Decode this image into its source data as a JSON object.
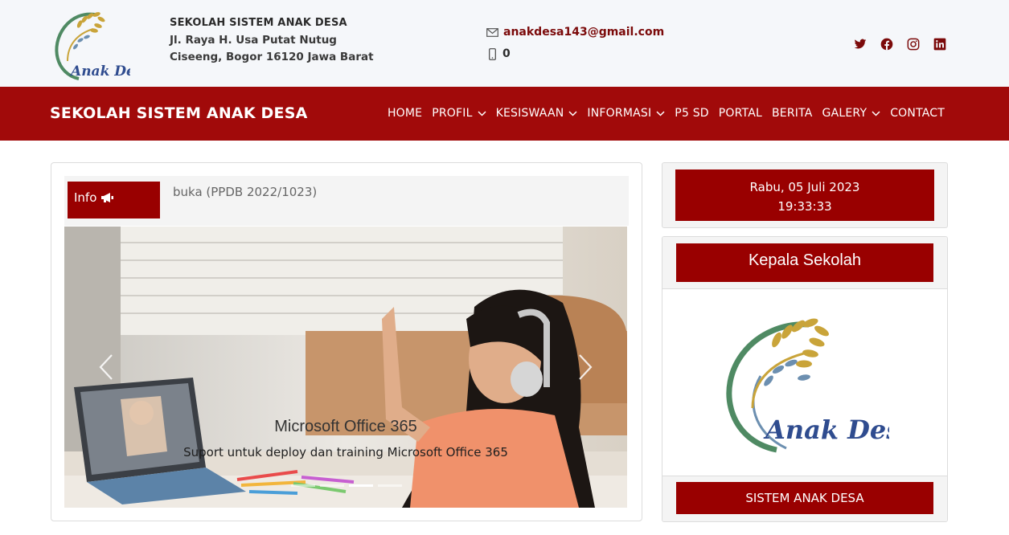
{
  "header": {
    "logo_text": "Anak Desa",
    "school_name": "SEKOLAH SISTEM ANAK DESA",
    "address_line1": "Jl. Raya H. Usa Putat Nutug",
    "address_line2": "Ciseeng, Bogor 16120 Jawa Barat",
    "email": "anakdesa143@gmail.com",
    "phone": "0",
    "social_icons": [
      "twitter-icon",
      "facebook-icon",
      "instagram-icon",
      "linkedin-icon"
    ]
  },
  "navbar": {
    "brand": "SEKOLAH SISTEM ANAK DESA",
    "items": [
      {
        "label": "HOME",
        "dropdown": false
      },
      {
        "label": "PROFIL",
        "dropdown": true
      },
      {
        "label": "KESISWAAN",
        "dropdown": true
      },
      {
        "label": "INFORMASI",
        "dropdown": true
      },
      {
        "label": "P5 SD",
        "dropdown": false
      },
      {
        "label": "PORTAL",
        "dropdown": false
      },
      {
        "label": "BERITA",
        "dropdown": false
      },
      {
        "label": "GALERY",
        "dropdown": true
      },
      {
        "label": "CONTACT",
        "dropdown": false
      }
    ]
  },
  "info": {
    "badge": "Info",
    "ticker": "buka (PPDB 2022/1023)"
  },
  "carousel": {
    "title": "Microsoft Office 365",
    "subtitle": "Suport untuk deploy dan training Microsoft Office 365",
    "slide_count": 4,
    "active_index": 2
  },
  "sidebar": {
    "date": "Rabu, 05 Juli 2023",
    "time": "19:33:33",
    "headmaster_title": "Kepala Sekolah",
    "headmaster_name": "SISTEM ANAK DESA",
    "headmaster_logo_text": "Anak Desa"
  },
  "colors": {
    "brand_red": "#a10a0a",
    "box_red": "#990000",
    "header_bg": "#f5f7fa"
  }
}
